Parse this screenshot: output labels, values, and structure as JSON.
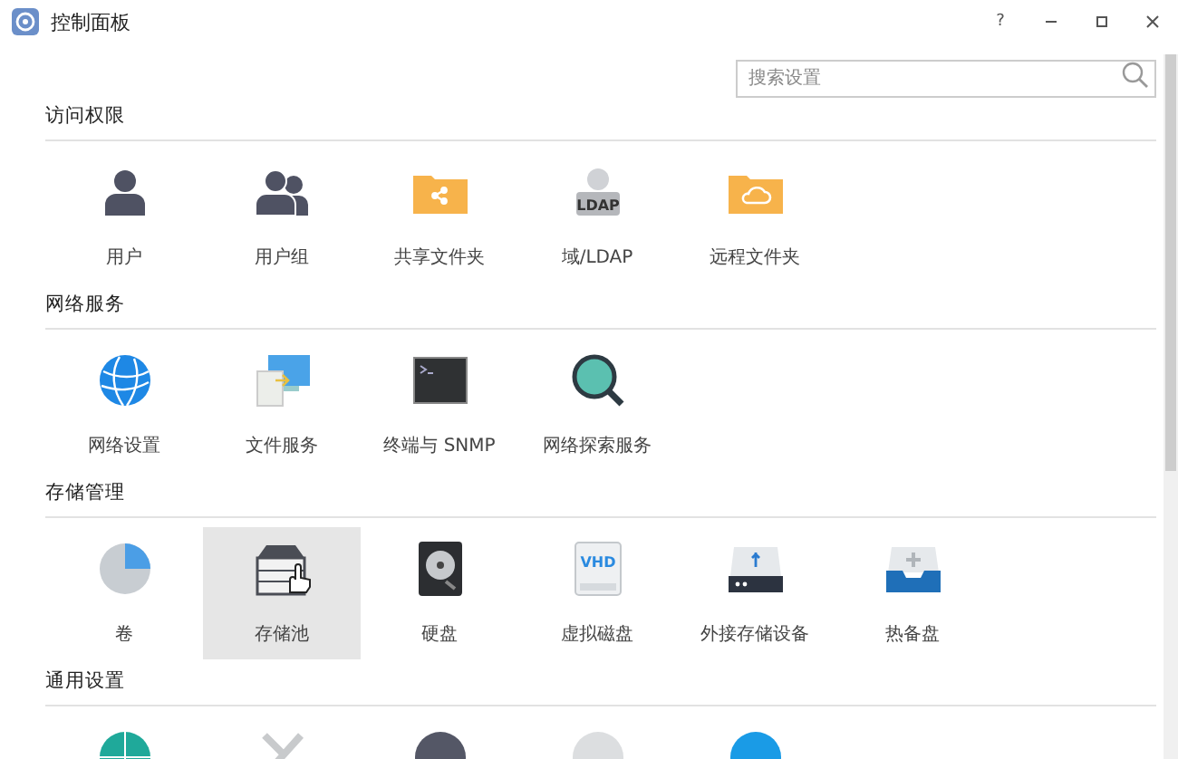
{
  "window": {
    "title": "控制面板"
  },
  "title_buttons": [
    {
      "kind": "help",
      "label": "?"
    },
    {
      "kind": "minimize"
    },
    {
      "kind": "maximize"
    },
    {
      "kind": "close"
    }
  ],
  "search": {
    "placeholder": "搜索设置"
  },
  "sections": [
    {
      "title": "访问权限",
      "items": [
        {
          "label": "用户",
          "kind": "user",
          "selected": false
        },
        {
          "label": "用户组",
          "kind": "group",
          "selected": false
        },
        {
          "label": "共享文件夹",
          "kind": "share-folder",
          "selected": false
        },
        {
          "label": "域/LDAP",
          "kind": "ldap",
          "badge": "LDAP",
          "selected": false
        },
        {
          "label": "远程文件夹",
          "kind": "cloud-folder",
          "selected": false
        }
      ]
    },
    {
      "title": "网络服务",
      "items": [
        {
          "label": "网络设置",
          "kind": "globe",
          "selected": false
        },
        {
          "label": "文件服务",
          "kind": "monitor",
          "selected": false
        },
        {
          "label": "终端与 SNMP",
          "kind": "terminal",
          "selected": false
        },
        {
          "label": "网络探索服务",
          "kind": "magnifier",
          "selected": false
        }
      ]
    },
    {
      "title": "存储管理",
      "items": [
        {
          "label": "卷",
          "kind": "pie",
          "selected": false
        },
        {
          "label": "存储池",
          "kind": "pool",
          "selected": true
        },
        {
          "label": "硬盘",
          "kind": "hdd",
          "selected": false
        },
        {
          "label": "虚拟磁盘",
          "kind": "vhd",
          "badge": "VHD",
          "selected": false
        },
        {
          "label": "外接存储设备",
          "kind": "usb",
          "selected": false
        },
        {
          "label": "热备盘",
          "kind": "tray",
          "selected": false
        }
      ]
    },
    {
      "title": "通用设置",
      "items": [
        {
          "kind": "teal-globe",
          "selected": false
        },
        {
          "kind": "tools",
          "selected": false
        },
        {
          "kind": "dark-circle",
          "selected": false
        },
        {
          "kind": "grey-circle",
          "selected": false
        },
        {
          "kind": "blue-circle",
          "selected": false
        }
      ]
    }
  ]
}
